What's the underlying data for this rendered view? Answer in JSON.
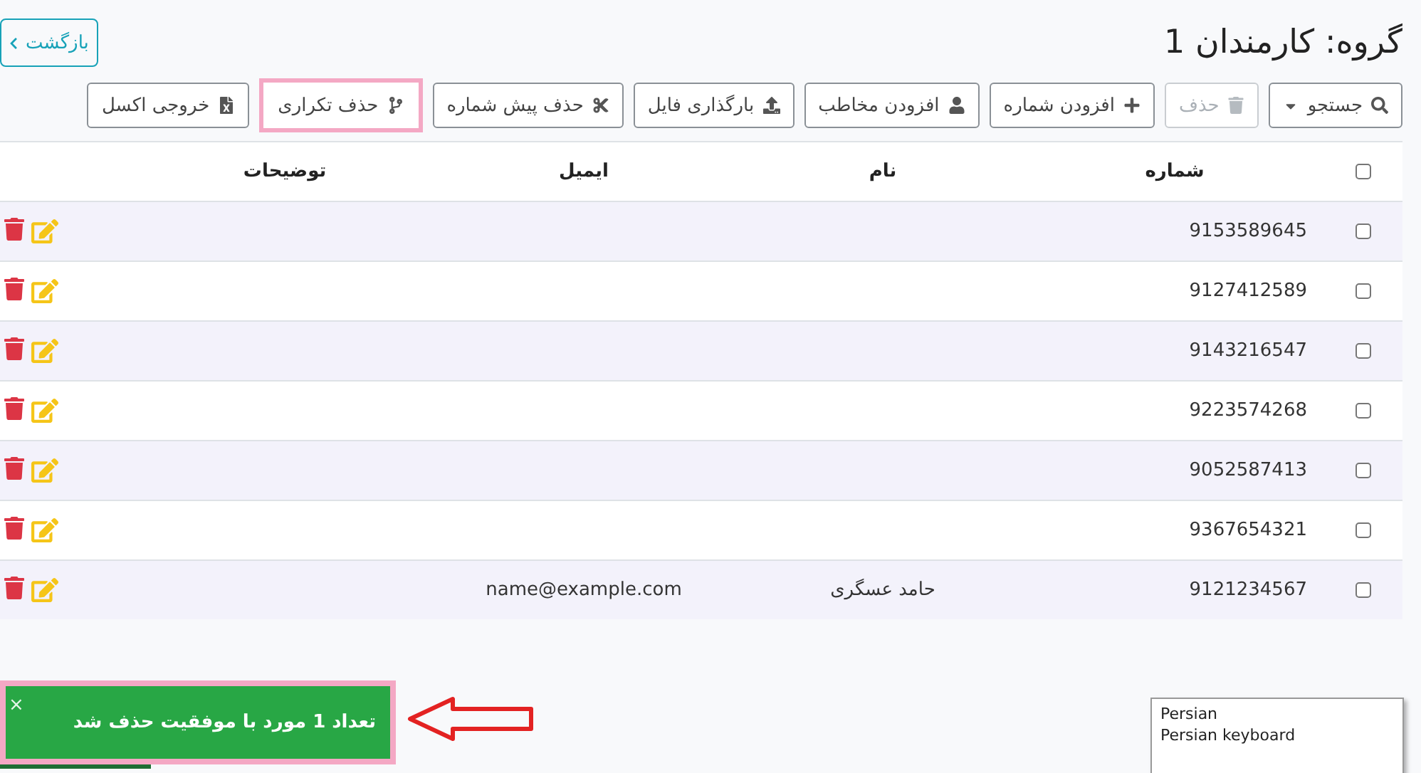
{
  "header": {
    "title": "گروه: کارمندان 1",
    "back_button": "بازگشت"
  },
  "toolbar": [
    {
      "label": "جستجو",
      "disabled": false,
      "highlighted": false,
      "dropdown": true
    },
    {
      "label": "حذف",
      "disabled": true,
      "highlighted": false,
      "dropdown": false
    },
    {
      "label": "افزودن شماره",
      "disabled": false,
      "highlighted": false,
      "dropdown": false
    },
    {
      "label": "افزودن مخاطب",
      "disabled": false,
      "highlighted": false,
      "dropdown": false
    },
    {
      "label": "بارگذاری فایل",
      "disabled": false,
      "highlighted": false,
      "dropdown": false
    },
    {
      "label": "حذف پیش شماره",
      "disabled": false,
      "highlighted": false,
      "dropdown": false
    },
    {
      "label": "حذف تکراری",
      "disabled": false,
      "highlighted": true,
      "dropdown": false
    },
    {
      "label": "خروجی اکسل",
      "disabled": false,
      "highlighted": false,
      "dropdown": false
    }
  ],
  "table": {
    "select_all": {
      "checked": false
    },
    "columns": [
      "شماره",
      "نام",
      "ایمیل",
      "توضیحات"
    ],
    "rows": [
      {
        "checked": false,
        "number": "9153589645"
      },
      {
        "checked": false,
        "number": "9127412589"
      },
      {
        "checked": false,
        "number": "9143216547"
      },
      {
        "checked": false,
        "number": "9223574268"
      },
      {
        "checked": false,
        "number": "9052587413"
      },
      {
        "checked": false,
        "number": "9367654321"
      },
      {
        "checked": false,
        "number": "9121234567",
        "name": "حامد عسگری",
        "email": "name@example.com"
      }
    ]
  },
  "toast": {
    "message": "تعداد 1 مورد با موفقیت حذف شد",
    "close": "×",
    "highlighted": true,
    "level": 0.38
  },
  "ime_popup": {
    "lines": [
      "Persian",
      "Persian keyboard"
    ]
  }
}
